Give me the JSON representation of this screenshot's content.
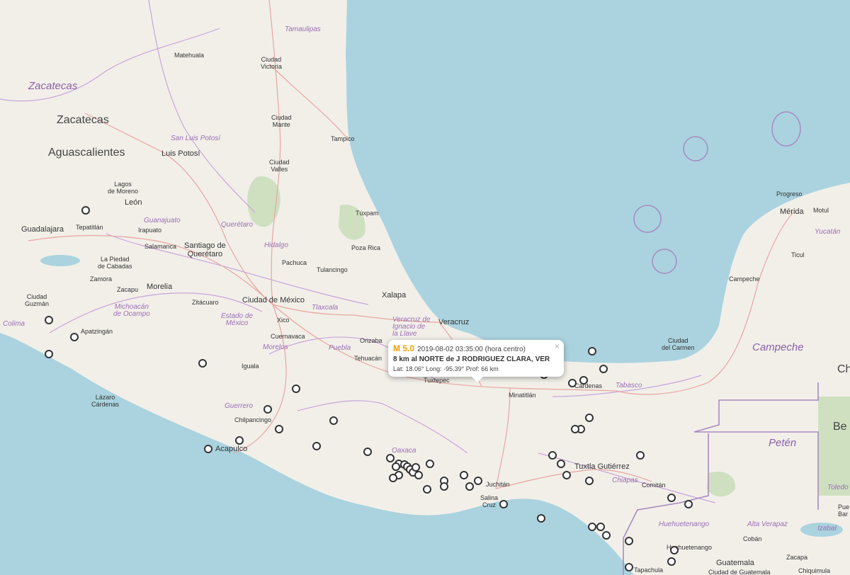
{
  "map": {
    "colors": {
      "land": "#f2efe9",
      "water": "#aad3df",
      "border": "#a78bbf",
      "highway": "#e8a5a0",
      "park": "#cfe0c0"
    },
    "labels": {
      "tamaulipas": "Tamaulipas",
      "matehuala": "Matehuala",
      "ciudad_victoria": "Ciudad\nVictoria",
      "zacatecas_state": "Zacatecas",
      "zacatecas_city": "Zacatecas",
      "aguascalientes": "Aguascalientes",
      "san_luis_potosi_state": "San Luis Potosí",
      "san_luis_potosi_city": "Luis Potosí",
      "ciudad_mante": "Ciudad\nMante",
      "tampico": "Tampico",
      "ciudad_valles": "Ciudad\nValles",
      "lagos_de_moreno": "Lagos\nde Moreno",
      "leon": "León",
      "guanajuato": "Guanajuato",
      "irapuato": "Irapuato",
      "tepatitlan": "Tepatitlán",
      "guadalajara": "Guadalajara",
      "queretaro_state": "Querétaro",
      "tuxpam": "Túxpam",
      "hidalgo": "Hidalgo",
      "poza_rica": "Poza Rica",
      "salamanca": "Salamanca",
      "santiago_de_queretaro": "Santiago de\nQuerétaro",
      "la_piedad": "La Piedad\nde Cabadas",
      "pachuca": "Pachuca",
      "tulancingo": "Tulancingo",
      "zamora": "Zamora",
      "zacapu": "Zacapu",
      "morelia": "Morelia",
      "xalapa": "Xalapa",
      "ciudad_guzman": "Ciudad\nGuzmán",
      "michoacan": "Michoacán\nde Ocampo",
      "zitacuaro": "Zitácuaro",
      "ciudad_de_mexico": "Ciudad de México",
      "tlaxcala": "Tlaxcala",
      "estado_de_mexico": "Estado de\nMéxico",
      "xico": "Xico",
      "veracruz_state": "Veracruz de\nIgnacio de\nla Llave",
      "veracruz_city": "Veracruz",
      "colima": "Colima",
      "apatzingan": "Apatzingán",
      "cuernavaca": "Cuernavaca",
      "morelos": "Morelos",
      "puebla": "Puebla",
      "orizaba": "Orizaba",
      "tehuacan": "Tehuacán",
      "iguala": "Iguala",
      "tuxtepec": "Tuxtepec",
      "lazaro_cardenas": "Lázaro\nCárdenas",
      "guerrero": "Guerrero",
      "chilpancingo": "Chilpancingo",
      "acapulco": "Acapulco",
      "oaxaca": "Oaxaca",
      "minatitlan": "Minatitlán",
      "cardenas": "Cárdenas",
      "tabasco": "Tabasco",
      "tuxtla": "Tuxtla Gutiérrez",
      "chiapas": "Chiapas",
      "comitan": "Comitán",
      "juchitan": "Juchitán",
      "salina_cruz": "Salina\nCruz",
      "progreso": "Progreso",
      "merida": "Mérida",
      "motul": "Motul",
      "yucatan": "Yucatán",
      "ticul": "Ticul",
      "campeche_city": "Campeche",
      "ciudad_del_carmen": "Ciudad\ndel Carmen",
      "campeche_state": "Campeche",
      "peten": "Petén",
      "belize": "Be",
      "ch": "Ch",
      "toledo": "Toledo",
      "puebla_cut": "Pue\nBar",
      "huehuetenango_state": "Huehuetenango",
      "alta_verapaz": "Alta Verapaz",
      "izabal": "Izabal",
      "huehuetenango_city": "Huehuetenango",
      "coban": "Cobán",
      "guatemala": "Guatemala",
      "ciudad_guatemala": "Ciudad de Guatemala",
      "zacapa": "Zacapa",
      "chiquimula": "Chiquimula",
      "tapachula": "Tapachula"
    }
  },
  "popup": {
    "magnitude": "M 5.0",
    "datetime": "2019-08-02  03:35:00 (hora centro)",
    "location": "8 km al NORTE de J RODRIGUEZ CLARA, VER",
    "coords": "Lat: 18.06°  Long: -95.39°  Prof: 66 km",
    "close": "×"
  },
  "earthquakes": [
    {
      "lat": 18.06,
      "lon": -95.39,
      "mag": 5.0,
      "selected": true
    },
    {
      "lat": 20.45,
      "lon": -103.35
    },
    {
      "lat": 18.55,
      "lon": -104.0
    },
    {
      "lat": 18.25,
      "lon": -103.55
    },
    {
      "lat": 17.95,
      "lon": -104.0
    },
    {
      "lat": 17.8,
      "lon": -101.3
    },
    {
      "lat": 17.35,
      "lon": -99.65
    },
    {
      "lat": 17.0,
      "lon": -100.15
    },
    {
      "lat": 16.65,
      "lon": -99.95
    },
    {
      "lat": 16.8,
      "lon": -99.0
    },
    {
      "lat": 16.45,
      "lon": -100.65
    },
    {
      "lat": 16.3,
      "lon": -101.2
    },
    {
      "lat": 16.35,
      "lon": -99.3
    },
    {
      "lat": 16.25,
      "lon": -98.4
    },
    {
      "lat": 16.15,
      "lon": -98.0
    },
    {
      "lat": 16.05,
      "lon": -97.85
    },
    {
      "lat": 16.0,
      "lon": -97.9
    },
    {
      "lat": 16.03,
      "lon": -97.75
    },
    {
      "lat": 16.0,
      "lon": -97.7
    },
    {
      "lat": 15.95,
      "lon": -97.65
    },
    {
      "lat": 15.9,
      "lon": -97.6
    },
    {
      "lat": 15.98,
      "lon": -97.55
    },
    {
      "lat": 15.85,
      "lon": -97.85
    },
    {
      "lat": 15.8,
      "lon": -97.95
    },
    {
      "lat": 15.85,
      "lon": -97.5
    },
    {
      "lat": 16.05,
      "lon": -97.3
    },
    {
      "lat": 15.75,
      "lon": -97.05
    },
    {
      "lat": 15.65,
      "lon": -97.05
    },
    {
      "lat": 15.85,
      "lon": -96.7
    },
    {
      "lat": 15.65,
      "lon": -96.6
    },
    {
      "lat": 15.75,
      "lon": -96.45
    },
    {
      "lat": 15.6,
      "lon": -97.35
    },
    {
      "lat": 15.35,
      "lon": -96.0
    },
    {
      "lat": 15.1,
      "lon": -95.35
    },
    {
      "lat": 17.6,
      "lon": -95.3
    },
    {
      "lat": 17.45,
      "lon": -94.8
    },
    {
      "lat": 17.5,
      "lon": -94.6
    },
    {
      "lat": 17.7,
      "lon": -94.25
    },
    {
      "lat": 18.0,
      "lon": -94.45
    },
    {
      "lat": 16.85,
      "lon": -94.5
    },
    {
      "lat": 16.65,
      "lon": -94.65
    },
    {
      "lat": 16.65,
      "lon": -94.75
    },
    {
      "lat": 16.2,
      "lon": -95.15
    },
    {
      "lat": 16.05,
      "lon": -95.0
    },
    {
      "lat": 15.85,
      "lon": -94.9
    },
    {
      "lat": 15.75,
      "lon": -94.5
    },
    {
      "lat": 16.2,
      "lon": -93.6
    },
    {
      "lat": 15.45,
      "lon": -93.05
    },
    {
      "lat": 15.35,
      "lon": -92.75
    },
    {
      "lat": 14.95,
      "lon": -94.45
    },
    {
      "lat": 14.95,
      "lon": -94.3
    },
    {
      "lat": 14.8,
      "lon": -94.2
    },
    {
      "lat": 14.7,
      "lon": -93.8
    },
    {
      "lat": 14.55,
      "lon": -93.0
    },
    {
      "lat": 14.35,
      "lon": -93.05
    },
    {
      "lat": 14.25,
      "lon": -93.8
    }
  ]
}
